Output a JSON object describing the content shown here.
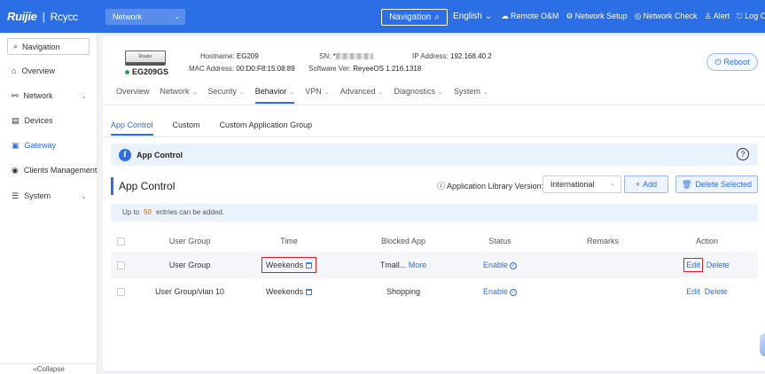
{
  "topbar": {
    "logo_left": "Ruijie",
    "logo_sep": "|",
    "logo_right": "Rcycc",
    "network_select": "Network",
    "navigation": "Navigation",
    "language": "English",
    "links": [
      "Remote O&M",
      "Network Setup",
      "Network Check",
      "Alert",
      "Log Out"
    ]
  },
  "sidebar": {
    "nav_button": "Navigation",
    "items": [
      {
        "label": "Overview"
      },
      {
        "label": "Network"
      },
      {
        "label": "Devices"
      },
      {
        "label": "Gateway"
      },
      {
        "label": "Clients Management"
      },
      {
        "label": "System"
      }
    ],
    "collapse": "«Collapse"
  },
  "device": {
    "image_label": "Router",
    "model": "EG209GS",
    "hostname_label": "Hostname:",
    "hostname": "EG209",
    "mac_label": "MAC Address:",
    "mac": "00:D0:F8:15:08:89",
    "sn_label": "SN:",
    "sn_prefix": "*",
    "software_label": "Software Ver:",
    "software": "ReyeeOS 1.216.1318",
    "ip_label": "IP Address:",
    "ip": "192.168.40.2",
    "reboot": "Reboot"
  },
  "menu": [
    {
      "label": "Overview",
      "dropdown": false
    },
    {
      "label": "Network",
      "dropdown": true
    },
    {
      "label": "Security",
      "dropdown": true
    },
    {
      "label": "Behavior",
      "dropdown": true
    },
    {
      "label": "VPN",
      "dropdown": true
    },
    {
      "label": "Advanced",
      "dropdown": true
    },
    {
      "label": "Diagnostics",
      "dropdown": true
    },
    {
      "label": "System",
      "dropdown": true
    }
  ],
  "subtabs": [
    "App Control",
    "Custom",
    "Custom Application Group"
  ],
  "banner": {
    "title": "App Control",
    "help": "?"
  },
  "section": {
    "title": "App Control",
    "lib_label": "Application Library Version:",
    "lib_value": "International",
    "add": "Add",
    "delete_selected": "Delete Selected"
  },
  "limit": {
    "prefix": "Up to",
    "num": "50",
    "suffix": "entries can be added."
  },
  "table": {
    "headers": [
      "User Group",
      "Time",
      "Blocked App",
      "Status",
      "Remarks",
      "Action"
    ],
    "rows": [
      {
        "user_group": "User Group",
        "time": "Weekends",
        "blocked_app": "Tmall...",
        "more": "More",
        "status": "Enable",
        "remarks": "",
        "edit": "Edit",
        "delete": "Delete"
      },
      {
        "user_group": "User Group/vlan 10",
        "time": "Weekends",
        "blocked_app": "Shopping",
        "more": "",
        "status": "Enable",
        "remarks": "",
        "edit": "Edit",
        "delete": "Delete"
      }
    ]
  },
  "colors": {
    "accent": "#2b6ee6",
    "highlight": "#d9221f",
    "warning": "#f0891e"
  }
}
